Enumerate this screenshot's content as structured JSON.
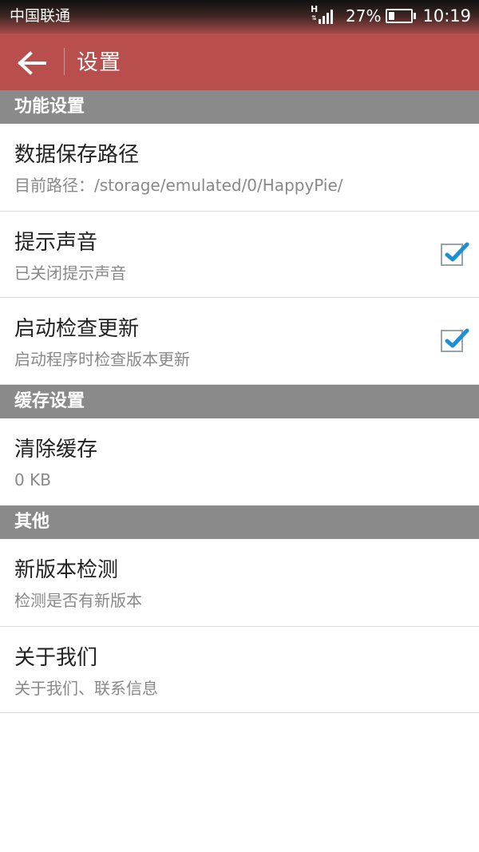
{
  "status_bar": {
    "carrier": "中国联通",
    "network_icon": "signal-h-icon",
    "battery_percent": "27%",
    "battery_level": 0.27,
    "battery_icon": "battery-icon",
    "time": "10:19"
  },
  "app_bar": {
    "back_icon": "arrow-left-icon",
    "title": "设置",
    "color": "#b84f4c"
  },
  "sections": [
    {
      "header": "功能设置",
      "items": [
        {
          "title": "数据保存路径",
          "summary": "目前路径：/storage/emulated/0/HappyPie/"
        },
        {
          "title": "提示声音",
          "summary": "已关闭提示声音",
          "checked": true
        },
        {
          "title": "启动检查更新",
          "summary": "启动程序时检查版本更新",
          "checked": true
        }
      ]
    },
    {
      "header": "缓存设置",
      "items": [
        {
          "title": "清除缓存",
          "summary": "0 KB"
        }
      ]
    },
    {
      "header": "其他",
      "items": [
        {
          "title": "新版本检测",
          "summary": "检测是否有新版本"
        },
        {
          "title": "关于我们",
          "summary": "关于我们、联系信息"
        }
      ]
    }
  ],
  "colors": {
    "section_header_bg": "#8a8a8a",
    "checkbox_check": "#1d8fd6"
  }
}
